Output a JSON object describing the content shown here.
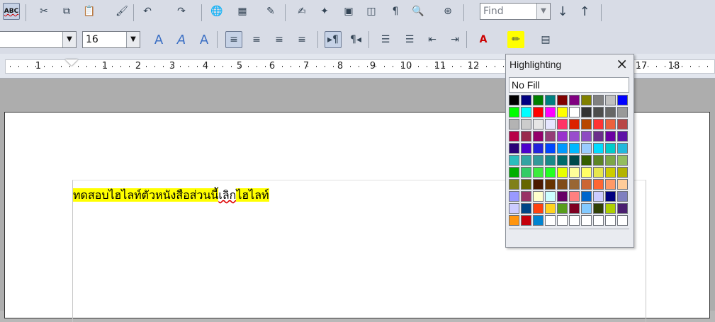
{
  "toolbar1": {
    "buttons": [
      {
        "name": "spellcheck-icon",
        "glyph": "ABC",
        "active": true
      },
      {
        "name": "cut-icon",
        "glyph": "✂"
      },
      {
        "name": "copy-icon",
        "glyph": "⧉"
      },
      {
        "name": "paste-icon",
        "glyph": "📋"
      },
      {
        "name": "clone-format-icon",
        "glyph": "🖌"
      },
      {
        "name": "undo-icon",
        "glyph": "↶"
      },
      {
        "name": "redo-icon",
        "glyph": "↷"
      },
      {
        "name": "hyperlink-icon",
        "glyph": "🌐"
      },
      {
        "name": "table-icon",
        "glyph": "▦"
      },
      {
        "name": "draw-functions-icon",
        "glyph": "✎"
      },
      {
        "name": "edit-file-icon",
        "glyph": "✍"
      },
      {
        "name": "navigator-icon",
        "glyph": "✦"
      },
      {
        "name": "gallery-icon",
        "glyph": "▣"
      },
      {
        "name": "data-sources-icon",
        "glyph": "◫"
      },
      {
        "name": "formatting-marks-icon",
        "glyph": "¶"
      },
      {
        "name": "zoom-icon",
        "glyph": "🔍"
      },
      {
        "name": "help-icon",
        "glyph": "⊛"
      }
    ],
    "find_placeholder": "Find",
    "find_next_icon": "↓",
    "find_prev_icon": "↑"
  },
  "toolbar2": {
    "font_name_value": "",
    "font_size_value": "16",
    "buttons": [
      {
        "name": "fontwork-icon",
        "glyph": "A"
      },
      {
        "name": "italic-a-icon",
        "glyph": "A"
      },
      {
        "name": "outline-a-icon",
        "glyph": "A"
      },
      {
        "name": "align-left-icon",
        "glyph": "≡",
        "active": true
      },
      {
        "name": "align-center-icon",
        "glyph": "≡"
      },
      {
        "name": "align-right-icon",
        "glyph": "≡"
      },
      {
        "name": "justify-icon",
        "glyph": "≡"
      },
      {
        "name": "ltr-icon",
        "glyph": "▸¶",
        "active": true
      },
      {
        "name": "rtl-icon",
        "glyph": "¶◂"
      },
      {
        "name": "numbering-icon",
        "glyph": "☰"
      },
      {
        "name": "bullets-icon",
        "glyph": "☰"
      },
      {
        "name": "decrease-indent-icon",
        "glyph": "⇤"
      },
      {
        "name": "increase-indent-icon",
        "glyph": "⇥"
      },
      {
        "name": "font-color-icon",
        "glyph": "A"
      },
      {
        "name": "highlighting-icon",
        "glyph": "✏"
      },
      {
        "name": "paragraph-background-icon",
        "glyph": "▤"
      }
    ]
  },
  "ruler": {
    "numbers": [
      "1",
      "1",
      "2",
      "3",
      "4",
      "5",
      "6",
      "7",
      "8",
      "9",
      "10",
      "11",
      "12",
      "17",
      "18"
    ]
  },
  "document": {
    "segments": [
      {
        "text": "ทดสอบไฮไลท์ตัวหนังสือส่วนนี้",
        "highlight": true
      },
      {
        "text": "เลิก",
        "highlight": false,
        "error": true
      },
      {
        "text": "ไฮไลท์",
        "highlight": true
      }
    ]
  },
  "popup": {
    "title": "Highlighting",
    "close_icon": "×",
    "no_fill_label": "No Fill",
    "colors": [
      "#000000",
      "#000080",
      "#008000",
      "#008080",
      "#800000",
      "#800080",
      "#808000",
      "#808080",
      "#c0c0c0",
      "#0000ff",
      "#00ff00",
      "#00ffff",
      "#ff0000",
      "#ff00ff",
      "#ffff00",
      "#ffffff",
      "#333333",
      "#4d4d4d",
      "#666666",
      "#999999",
      "#b3b3b3",
      "#cccccc",
      "#e6e6e6",
      "#e6e6ff",
      "#ff3366",
      "#dc2300",
      "#b84700",
      "#ff3333",
      "#eb613d",
      "#b84747",
      "#b80047",
      "#99284d",
      "#94006b",
      "#943d77",
      "#9933cc",
      "#994ccc",
      "#8e4bc2",
      "#6b2e8a",
      "#6b00a3",
      "#5e11a6",
      "#2a0078",
      "#4d00cc",
      "#2323dc",
      "#0047ff",
      "#0099ff",
      "#00b8ff",
      "#99ccff",
      "#00dcff",
      "#00cccc",
      "#23b8dc",
      "#2bbdbd",
      "#33a3a3",
      "#339999",
      "#198a8a",
      "#006b6b",
      "#004a4a",
      "#355e00",
      "#5c8526",
      "#7da647",
      "#94bd5e",
      "#00ae00",
      "#33cc66",
      "#3deb3d",
      "#23ff23",
      "#e6ff00",
      "#ffff99",
      "#ffff66",
      "#e6e64c",
      "#cccc00",
      "#b3b300",
      "#808019",
      "#666600",
      "#4c1900",
      "#663300",
      "#804c19",
      "#996633",
      "#cc6633",
      "#ff6633",
      "#ff9966",
      "#ffcc99",
      "#9999ff",
      "#993366",
      "#ffffcc",
      "#ccffff",
      "#660066",
      "#ff8080",
      "#0066cc",
      "#ccccff",
      "#000080",
      "#8080c0",
      "#ccccff",
      "#004586",
      "#ff420e",
      "#ffd320",
      "#579d1c",
      "#7e0021",
      "#83caff",
      "#314004",
      "#aecf00",
      "#4b1f6f",
      "#ff950e",
      "#c5000b",
      "#0084d1",
      "#ffffff",
      "#ffffff",
      "#ffffff",
      "#ffffff",
      "#ffffff",
      "#ffffff",
      "#ffffff"
    ]
  }
}
